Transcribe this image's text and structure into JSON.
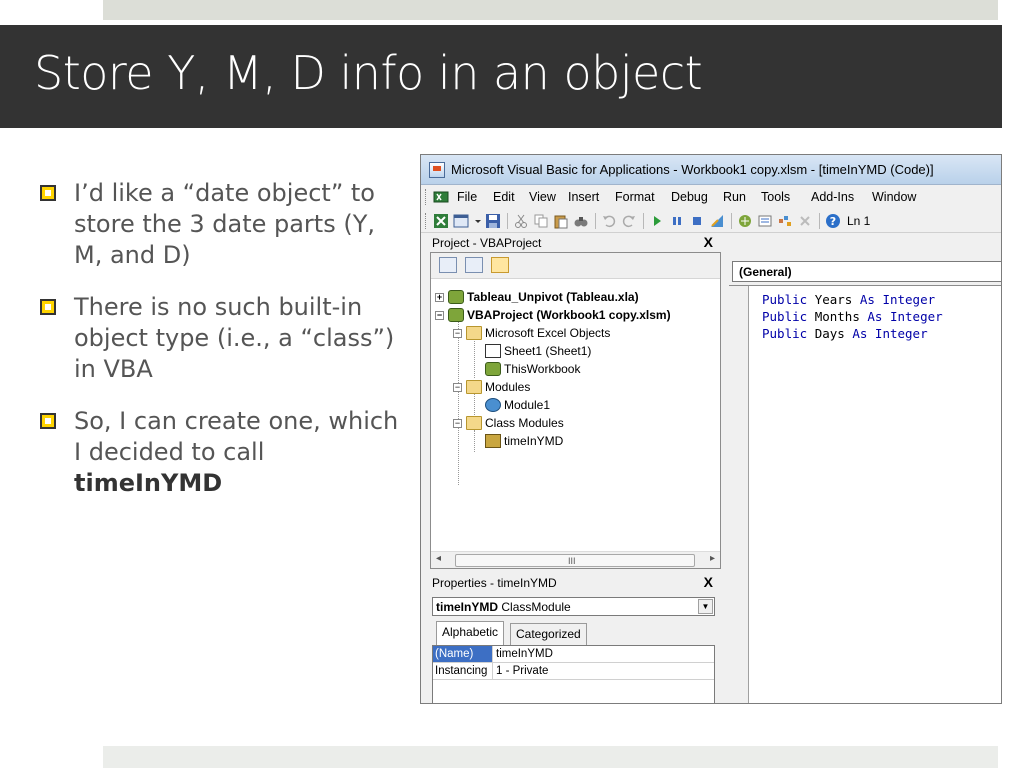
{
  "slide": {
    "title": "Store Y, M, D info in an object",
    "bullets": [
      {
        "text": "I’d like a “date object” to store the 3 date parts (Y, M, and D)"
      },
      {
        "text": "There is no such built-in object type (i.e., a “class”) in VBA"
      },
      {
        "text_before": "So, I can create one, which I decided to call ",
        "bold": "timeInYMD"
      }
    ],
    "accent_color": "#ffd400"
  },
  "vba": {
    "window_title": "Microsoft Visual Basic for Applications - Workbook1 copy.xlsm - [timeInYMD (Code)]",
    "menu": [
      "File",
      "Edit",
      "View",
      "Insert",
      "Format",
      "Debug",
      "Run",
      "Tools",
      "Add-Ins",
      "Window"
    ],
    "toolbar_ln": "Ln 1",
    "project_pane": {
      "title": "Project - VBAProject",
      "close": "X",
      "tree": [
        {
          "label": "Tableau_Unpivot (Tableau.xla)",
          "icon": "vbproject-icon",
          "expander": "+"
        },
        {
          "label": "VBAProject (Workbook1 copy.xlsm)",
          "icon": "vbproject-icon",
          "expander": "−"
        },
        {
          "label": "Microsoft Excel Objects",
          "icon": "folder-icon",
          "expander": "−"
        },
        {
          "label": "Sheet1 (Sheet1)",
          "icon": "sheet-icon"
        },
        {
          "label": "ThisWorkbook",
          "icon": "workbook-icon"
        },
        {
          "label": "Modules",
          "icon": "folder-icon",
          "expander": "−"
        },
        {
          "label": "Module1",
          "icon": "module-icon"
        },
        {
          "label": "Class Modules",
          "icon": "folder-icon",
          "expander": "−"
        },
        {
          "label": "timeInYMD",
          "icon": "class-module-icon"
        }
      ],
      "scroll_grip": "III"
    },
    "properties_pane": {
      "title": "Properties - timeInYMD",
      "close": "X",
      "object_name": "timeInYMD",
      "object_type": "ClassModule",
      "tabs": [
        "Alphabetic",
        "Categorized"
      ],
      "rows": [
        {
          "name": "(Name)",
          "value": "timeInYMD"
        },
        {
          "name": "Instancing",
          "value": "1 - Private"
        }
      ]
    },
    "code_pane": {
      "object_dropdown": "(General)",
      "lines": [
        {
          "kw1": "Public",
          "name": "Years",
          "kw2": "As",
          "kw3": "Integer"
        },
        {
          "kw1": "Public",
          "name": "Months",
          "kw2": "As",
          "kw3": "Integer"
        },
        {
          "kw1": "Public",
          "name": "Days",
          "kw2": "As",
          "kw3": "Integer"
        }
      ]
    }
  }
}
